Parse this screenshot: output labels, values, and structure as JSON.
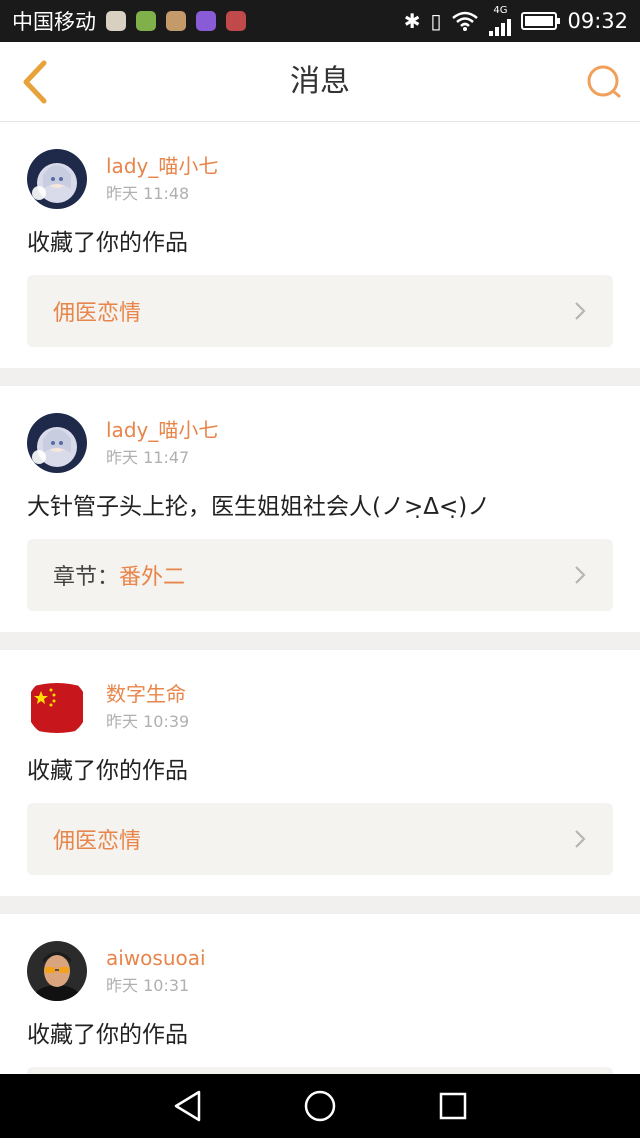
{
  "status_bar": {
    "carrier": "中国移动",
    "network": "4G",
    "time": "09:32",
    "notification_icons": [
      "app-icon-1",
      "app-icon-2",
      "app-icon-3",
      "gallery-icon",
      "app-icon-5"
    ],
    "bluetooth_glyph": "✱",
    "vibrate_glyph": "▯",
    "battery_level": 1.0
  },
  "header": {
    "title": "消息",
    "accent": "#e8a23a",
    "back_icon": "chevron-left-icon",
    "search_icon": "search-icon"
  },
  "messages": [
    {
      "username": "lady_喵小七",
      "time": "昨天 11:48",
      "text": "收藏了你的作品",
      "ref_prefix": "",
      "ref_title": "佣医恋情",
      "avatar": "anime-girl-avatar"
    },
    {
      "username": "lady_喵小七",
      "time": "昨天 11:47",
      "text": "大针管子头上抡，医生姐姐社会人(ノ>̣Δ<̣)ノ",
      "ref_prefix": "章节：",
      "ref_title": "番外二",
      "avatar": "anime-girl-avatar"
    },
    {
      "username": "数字生命",
      "time": "昨天 10:39",
      "text": "收藏了你的作品",
      "ref_prefix": "",
      "ref_title": "佣医恋情",
      "avatar": "flag-avatar"
    },
    {
      "username": "aiwosuoai",
      "time": "昨天 10:31",
      "text": "收藏了你的作品",
      "ref_prefix": "",
      "ref_title": "",
      "avatar": "man-with-sunglasses-avatar"
    }
  ],
  "colors": {
    "accent_orange": "#e8854a",
    "time_gray": "#b0b0b0",
    "ref_bg": "#f4f3ef",
    "page_bg": "#f1f0ee"
  },
  "nav_bar": {
    "back_icon": "triangle-back-icon",
    "home_icon": "circle-home-icon",
    "recent_icon": "square-recent-icon"
  }
}
